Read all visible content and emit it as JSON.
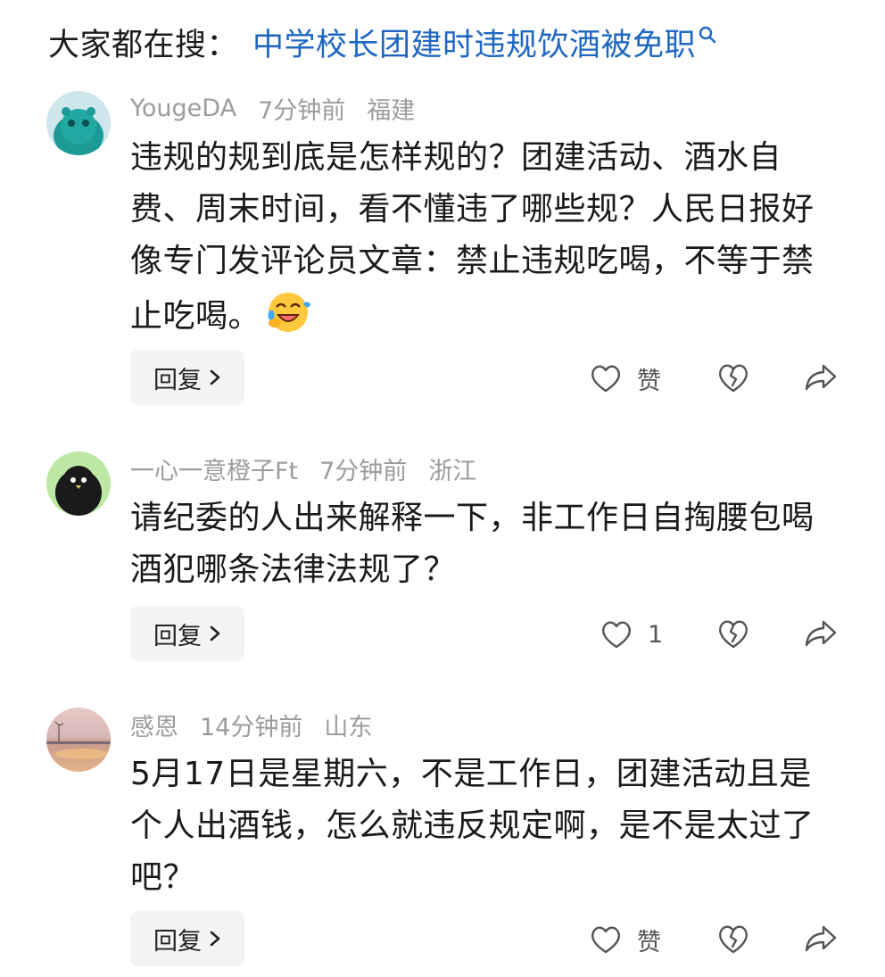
{
  "search": {
    "prefix": "大家都在搜：",
    "term": "中学校长团建时违规饮酒被免职"
  },
  "comments": [
    {
      "username": "YougeDA",
      "time": "7分钟前",
      "location": "福建",
      "text": "违规的规到底是怎样规的？团建活动、酒水自费、周末时间，看不懂违了哪些规？人民日报好像专门发评论员文章：禁止违规吃喝，不等于禁止吃喝。",
      "reply_label": "回复",
      "like_label": "赞"
    },
    {
      "username": "一心一意橙子Ft",
      "time": "7分钟前",
      "location": "浙江",
      "text": "请纪委的人出来解释一下，非工作日自掏腰包喝酒犯哪条法律法规了？",
      "reply_label": "回复",
      "like_label": "1"
    },
    {
      "username": "感恩",
      "time": "14分钟前",
      "location": "山东",
      "text": "5月17日是星期六，不是工作日，团建活动且是个人出酒钱，怎么就违反规定啊，是不是太过了吧？",
      "reply_label": "回复",
      "like_label": "赞"
    }
  ],
  "icons": {
    "emoji": "laughing-crying-emoji",
    "like": "heart-outline-icon",
    "dislike": "broken-heart-icon",
    "share": "share-arrow-icon",
    "search": "search-icon"
  },
  "colors": {
    "search_term": "#1e67c2",
    "meta_text": "#9c9c9c",
    "reply_bg": "#f4f4f4"
  }
}
